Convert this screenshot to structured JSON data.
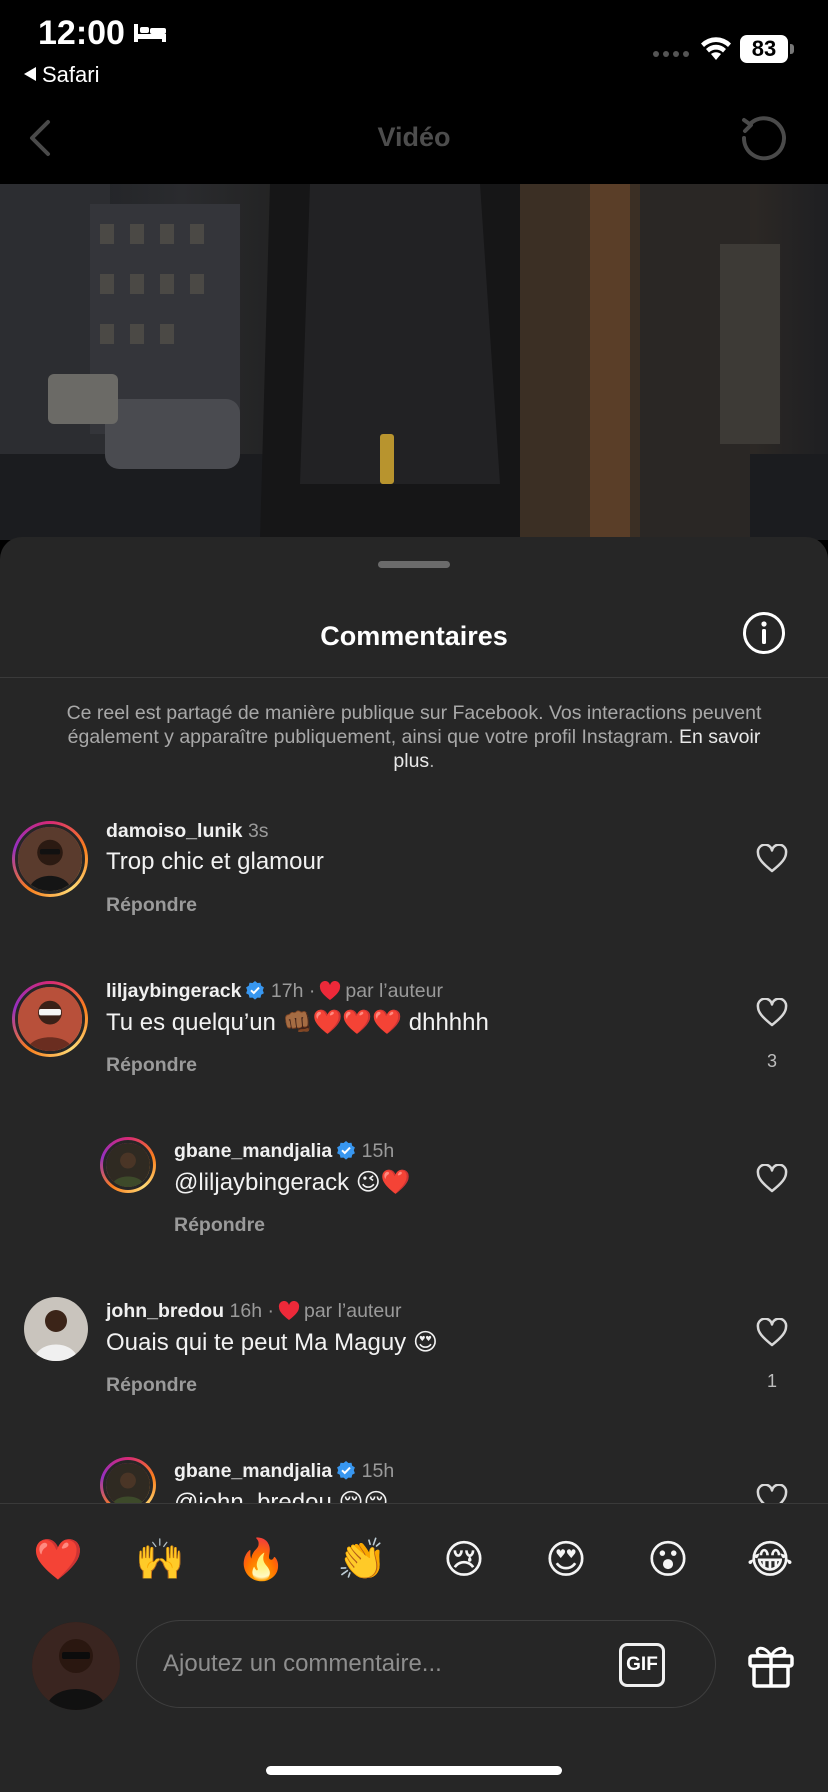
{
  "status_bar": {
    "time": "12:00",
    "back_app": "Safari",
    "battery": "83"
  },
  "header": {
    "title": "Vidéo"
  },
  "sheet": {
    "title": "Commentaires",
    "notice_text": "Ce reel est partagé de manière publique sur Facebook. Vos interactions peuvent également y apparaître publiquement, ainsi que votre profil Instagram.",
    "notice_link": "En savoir plus",
    "notice_end": "."
  },
  "comments": [
    {
      "user": "damoiso_lunik",
      "verified": false,
      "time": "3s",
      "liked_by_author": false,
      "author_label": "",
      "text": "Trop chic et glamour",
      "reply_label": "Répondre",
      "likes": ""
    },
    {
      "user": "liljaybingerack",
      "verified": true,
      "time": "17h",
      "liked_by_author": true,
      "author_label": "par l’auteur",
      "text": "Tu es quelqu’un 👊🏾❤️❤️❤️ dhhhhh",
      "reply_label": "Répondre",
      "likes": "3"
    },
    {
      "user": "gbane_mandjalia",
      "verified": true,
      "time": "15h",
      "liked_by_author": false,
      "author_label": "",
      "text": "@liljaybingerack 😉❤️",
      "reply_label": "Répondre",
      "likes": ""
    },
    {
      "user": "john_bredou",
      "verified": false,
      "time": "16h",
      "liked_by_author": true,
      "author_label": "par l’auteur",
      "text": "Ouais qui te peut Ma Maguy 😍",
      "reply_label": "Répondre",
      "likes": "1"
    },
    {
      "user": "gbane_mandjalia",
      "verified": true,
      "time": "15h",
      "liked_by_author": false,
      "author_label": "",
      "text": "@john_bredou 😌😌",
      "reply_label": "",
      "likes": ""
    }
  ],
  "reactions": [
    "❤️",
    "🙌",
    "🔥",
    "👏",
    "😢",
    "😍",
    "😮",
    "😂"
  ],
  "composer": {
    "placeholder": "Ajoutez un commentaire...",
    "gif_label": "GIF"
  },
  "colors": {
    "sheet_bg": "#262626",
    "verified_blue": "#3897f0",
    "heart_red": "#ed2939",
    "muted_text": "#9a9a9a"
  }
}
